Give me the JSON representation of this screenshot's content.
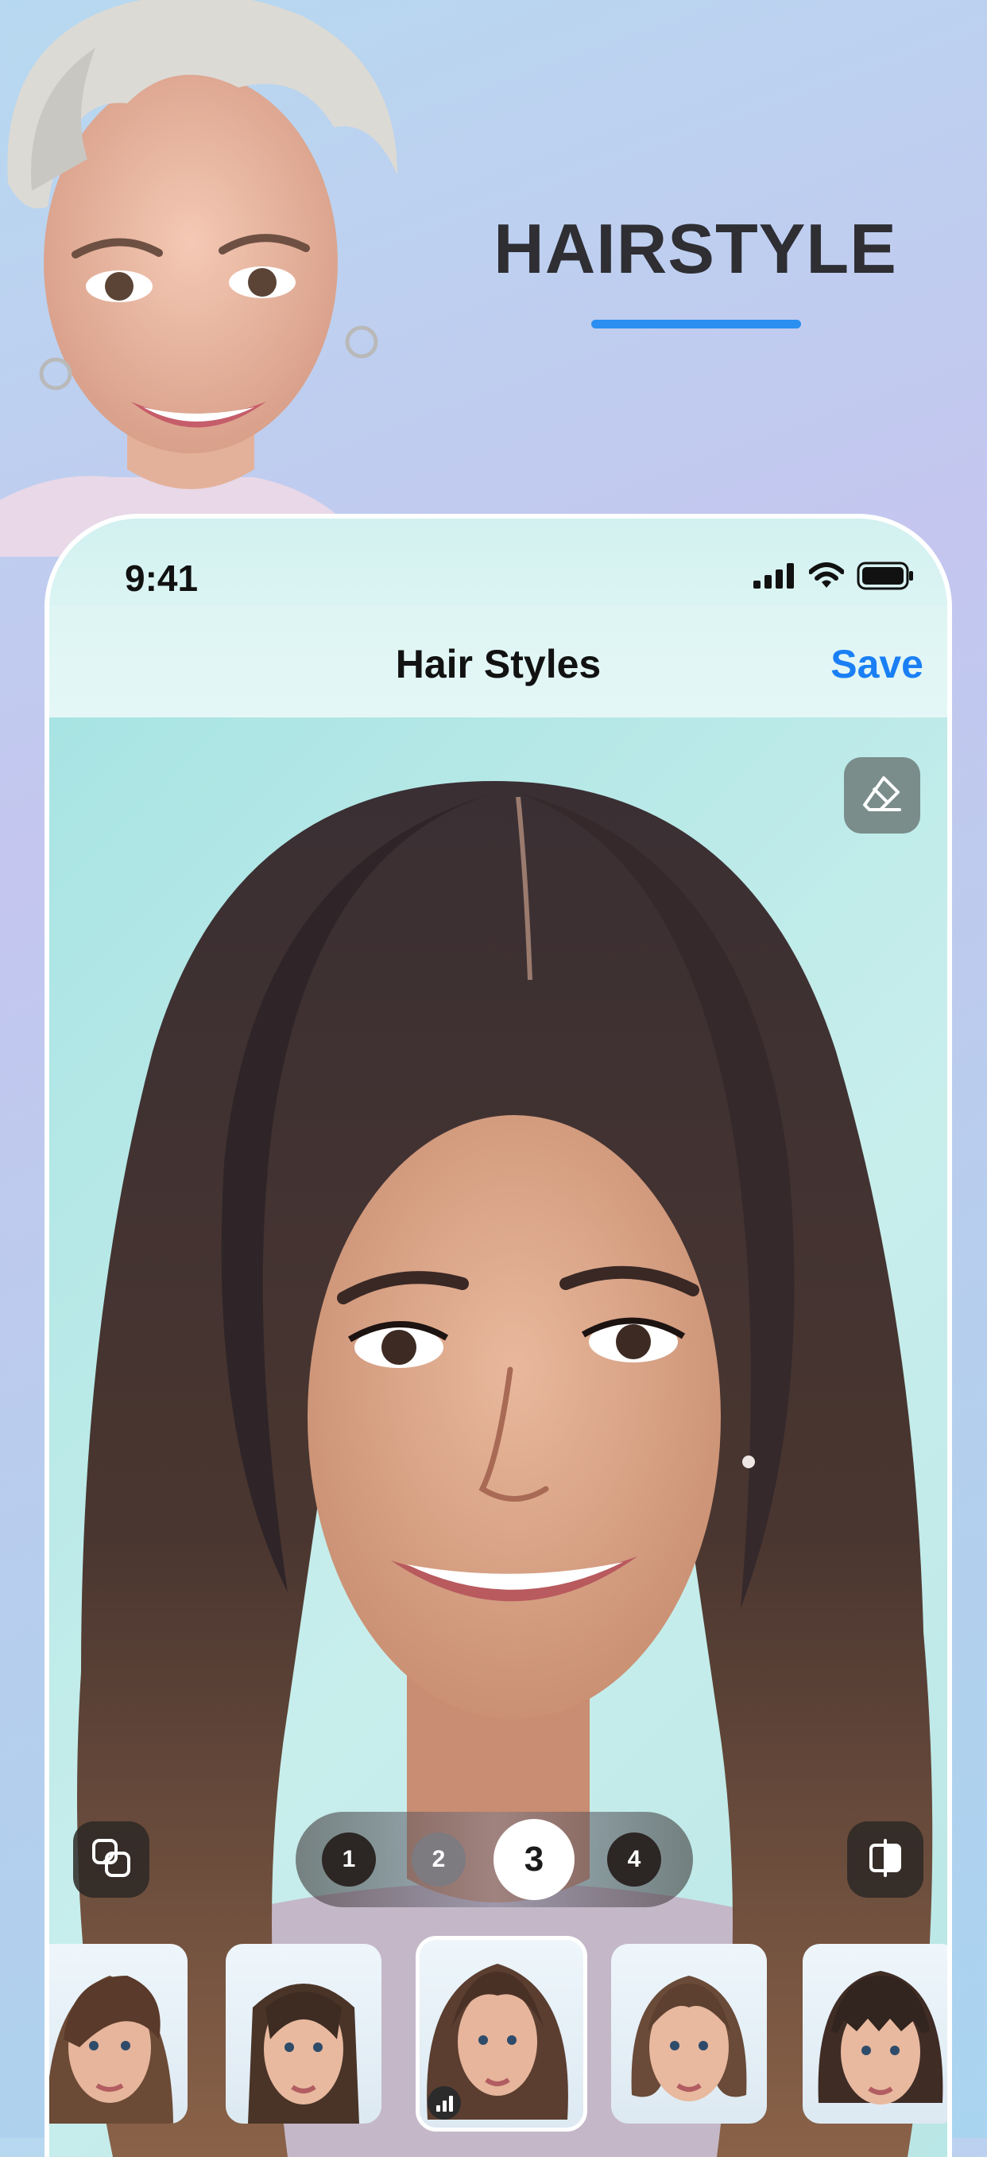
{
  "promo": {
    "title": "HAIRSTYLE",
    "accent_color": "#2a8ff0"
  },
  "status_bar": {
    "time": "9:41",
    "icons": [
      "signal-icon",
      "wifi-icon",
      "battery-icon"
    ]
  },
  "nav": {
    "title": "Hair Styles",
    "save_label": "Save",
    "save_color": "#1a7ff5"
  },
  "editor": {
    "tools": [
      "eraser-icon",
      "layers-icon",
      "compare-icon"
    ],
    "intensity_options": [
      "1",
      "2",
      "3",
      "4"
    ],
    "intensity_selected": "3"
  },
  "styles": {
    "thumbnails": [
      "side-swept-pixie",
      "long-straight",
      "layered-waves",
      "bob",
      "bangs-bob"
    ],
    "selected_index": 2
  }
}
